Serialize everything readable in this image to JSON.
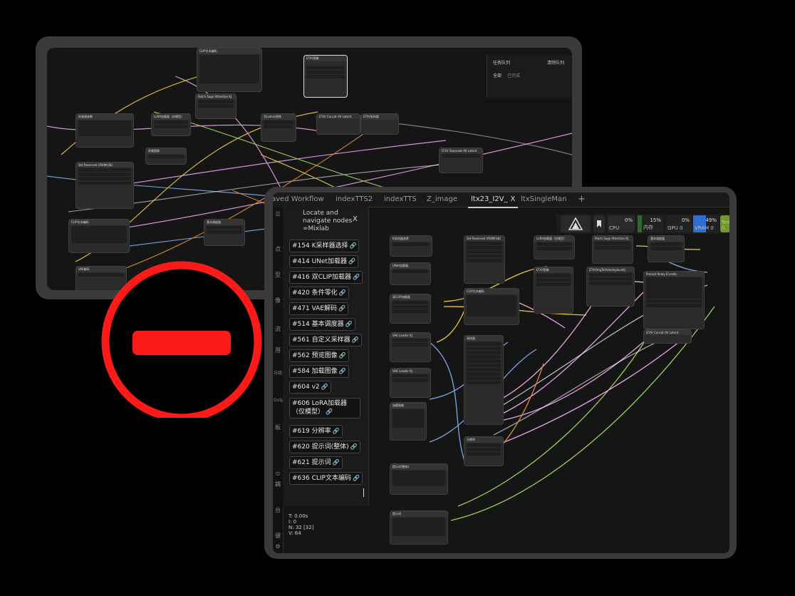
{
  "back_window": {
    "queue_title": "任务队列",
    "queue_clear": "清除队列",
    "queue_tab_all": "全部",
    "queue_tab_done": "已完成",
    "nodes": [
      "CLIP文本编码",
      "LTXV图像",
      "Patch Sage Attention KJ",
      "检查器参数",
      "LoRA加载器（仅模型）",
      "空Latent视频",
      "LTXV Concat AV Latent",
      "LTXV采样器",
      "Set Reserved VRAM(GB)",
      "CLIP文本编码",
      "剪裁图像",
      "LTXV Separate AV Latent",
      "基本调度器",
      "VAE解码"
    ]
  },
  "front_window": {
    "tabs": [
      {
        "label": "aved Workflow",
        "active": false
      },
      {
        "label": "indexTTS2",
        "active": false
      },
      {
        "label": "indexTTS",
        "active": false
      },
      {
        "label": "Z_image",
        "active": false
      },
      {
        "label": "ltx23_I2V_",
        "active": true
      },
      {
        "label": "ltxSingleMan",
        "active": false
      }
    ],
    "tab_close": "X",
    "tab_add": "+",
    "left_icons": [
      "☰",
      "点",
      "型",
      "像",
      "流",
      "用",
      "与组",
      "Outp",
      "板",
      "⊙",
      "⊘",
      "耦",
      "合",
      "台",
      "键",
      "⚙"
    ],
    "locate_panel": {
      "title": "Locate and navigate nodes ∞Mixlab",
      "close": "X",
      "items": [
        "#154 K采样器选择",
        "#414 UNet加载器",
        "#416 双CLIP加载器",
        "#420 条件零化",
        "#471 VAE解码",
        "#514 基本调度器",
        "#561 自定义采样器",
        "#562 预览图像",
        "#584 加载图像",
        "#604 v2",
        "#606 LoRA加载器（仅模型）",
        "#619 分辨率",
        "#620 提示词(整体)",
        "#621 提示词",
        "#636 CLIP文本编码"
      ],
      "link_icon": "🔗"
    },
    "stats": {
      "t": "T: 0.00s",
      "i": "I: 0",
      "n": "N: 32 [32]",
      "v": "V: 64"
    },
    "monitor": {
      "cpu_label": "CPU",
      "cpu_pct": "0%",
      "mem_label": "内存",
      "mem_pct": "15%",
      "gpu_label": "GPU 0",
      "gpu_pct": "0%",
      "vram_label": "VRAM 0",
      "vram_pct": "49%",
      "temp_label": "Temp 0"
    },
    "nodes": [
      "K采样器选择",
      "Set Reserved VRAM(GB)",
      "LoRA加载器（仅模型）",
      "Patch Sage Attention KJ",
      "基本调度器",
      "UNet加载器",
      "LTXV图像",
      "LTXVImgToVideoInplaceKJ",
      "Prompt Relay Encode",
      "双CLIP加载器",
      "CLIP文本编码",
      "VAE Loader KJ",
      "LTXV Concat AV Latent",
      "采样器",
      "加载图像",
      "分辨率",
      "提示词(整体)",
      "提示词"
    ]
  },
  "colors": {
    "accent_red": "#ff1a1a",
    "cpu": "#3a3a3a",
    "mem": "#2f6b2a",
    "vram": "#2f6dd0",
    "temp": "#6f9a2a"
  }
}
